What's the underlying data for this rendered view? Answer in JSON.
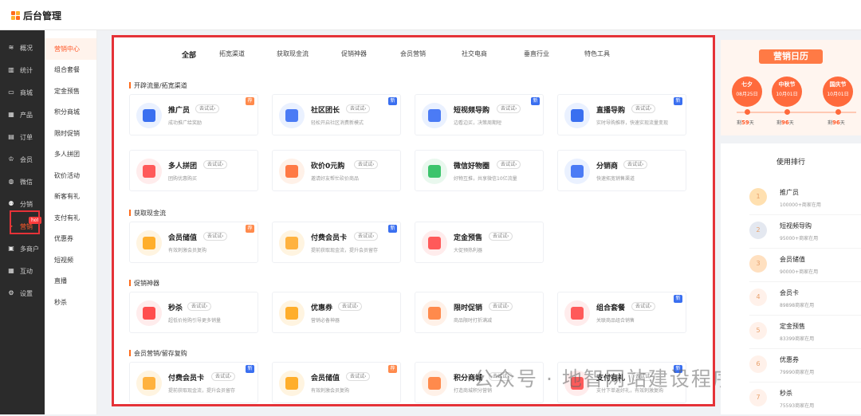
{
  "app": {
    "title": "后台管理"
  },
  "sidebar": {
    "items": [
      {
        "label": "概况",
        "icon": "layers-icon",
        "glyph": "≋"
      },
      {
        "label": "统计",
        "icon": "bar-chart-icon",
        "glyph": "▥"
      },
      {
        "label": "商城",
        "icon": "store-icon",
        "glyph": "▭"
      },
      {
        "label": "产品",
        "icon": "grid-icon",
        "glyph": "▦"
      },
      {
        "label": "订单",
        "icon": "order-icon",
        "glyph": "▤"
      },
      {
        "label": "会员",
        "icon": "crown-icon",
        "glyph": "♔"
      },
      {
        "label": "微信",
        "icon": "wechat-icon",
        "glyph": "◍"
      },
      {
        "label": "分销",
        "icon": "users-icon",
        "glyph": "⚉"
      },
      {
        "label": "营销",
        "icon": "marketing-icon",
        "glyph": "▸",
        "active": true,
        "badge": "hot"
      },
      {
        "label": "多商户",
        "icon": "merchant-icon",
        "glyph": "▣"
      },
      {
        "label": "互动",
        "icon": "interaction-icon",
        "glyph": "▦"
      },
      {
        "label": "设置",
        "icon": "gear-icon",
        "glyph": "⚙"
      }
    ]
  },
  "subnav": {
    "items": [
      "营销中心",
      "组合套餐",
      "定金预售",
      "积分商城",
      "限时促销",
      "多人拼团",
      "砍价活动",
      "新客有礼",
      "支付有礼",
      "优惠券",
      "短视频",
      "直播",
      "秒杀"
    ]
  },
  "tabs": [
    "全部",
    "拓宽渠道",
    "获取现金流",
    "促销神器",
    "会员营销",
    "社交电商",
    "垂直行业",
    "特色工具"
  ],
  "try_label": "去试试›",
  "sections": [
    {
      "title": "开辟流量/拓宽渠道",
      "cards": [
        {
          "name": "推广员",
          "desc": "成功推广给奖励",
          "tag": "荐",
          "tagColor": "#ff8a4c",
          "icon": "megaphone-icon",
          "bg": "#eaf1ff",
          "fg": "#3a6ff0"
        },
        {
          "name": "社区团长",
          "desc": "轻松开启社区消费新模式",
          "tag": "新",
          "tagColor": "#3a6ff0",
          "icon": "community-leader-icon",
          "bg": "#eaf1ff",
          "fg": "#4b7bf5"
        },
        {
          "name": "短视频导购",
          "desc": "边看边买，决策周期短",
          "tag": "新",
          "tagColor": "#3a6ff0",
          "icon": "video-shop-icon",
          "bg": "#eaf1ff",
          "fg": "#4b7bf5"
        },
        {
          "name": "直播导购",
          "desc": "实时导购推荐，快速实现流量变现",
          "tag": "新",
          "tagColor": "#3a6ff0",
          "icon": "live-icon",
          "bg": "#eaf1ff",
          "fg": "#3a6ff0"
        },
        {
          "name": "多人拼团",
          "desc": "团购优惠购买",
          "tag": "",
          "tagColor": "",
          "icon": "group-buy-icon",
          "bg": "#ffecec",
          "fg": "#ff5a5a"
        },
        {
          "name": "砍价0元购",
          "desc": "邀请好友帮忙砍价商品",
          "tag": "",
          "tagColor": "",
          "icon": "bargain-icon",
          "bg": "#fff1e8",
          "fg": "#ff7a45"
        },
        {
          "name": "微信好物圈",
          "desc": "好物互推，共享微信10亿流量",
          "tag": "",
          "tagColor": "",
          "icon": "wechat-circle-icon",
          "bg": "#e9f8ee",
          "fg": "#3cc46c"
        },
        {
          "name": "分销商",
          "desc": "快速拓宽销售渠道",
          "tag": "",
          "tagColor": "",
          "icon": "distributor-icon",
          "bg": "#eaf1ff",
          "fg": "#4b7bf5"
        }
      ]
    },
    {
      "title": "获取现金流",
      "cards": [
        {
          "name": "会员储值",
          "desc": "有效刺激会员复购",
          "tag": "荐",
          "tagColor": "#ff8a4c",
          "icon": "stored-value-icon",
          "bg": "#fff4e0",
          "fg": "#ffae2b"
        },
        {
          "name": "付费会员卡",
          "desc": "提前获取现金流，提升会员留存",
          "tag": "新",
          "tagColor": "#3a6ff0",
          "icon": "vip-card-icon",
          "bg": "#fff4e0",
          "fg": "#ffb23f"
        },
        {
          "name": "定金预售",
          "desc": "大促预热利器",
          "tag": "",
          "tagColor": "",
          "icon": "presale-icon",
          "bg": "#ffecec",
          "fg": "#ff5a5a"
        }
      ]
    },
    {
      "title": "促销神器",
      "cards": [
        {
          "name": "秒杀",
          "desc": "超低价抢购引导更多销量",
          "tag": "",
          "tagColor": "",
          "icon": "flash-sale-icon",
          "bg": "#ffecec",
          "fg": "#ff4d4d"
        },
        {
          "name": "优惠券",
          "desc": "营销必备神器",
          "tag": "",
          "tagColor": "",
          "icon": "coupon-icon",
          "bg": "#fff4e0",
          "fg": "#ffae2b"
        },
        {
          "name": "限时促销",
          "desc": "商品限时打折满减",
          "tag": "",
          "tagColor": "",
          "icon": "discount-icon",
          "bg": "#fff1e8",
          "fg": "#ff8a4c"
        },
        {
          "name": "组合套餐",
          "desc": "关联商品组合销售",
          "tag": "新",
          "tagColor": "#3a6ff0",
          "icon": "bundle-icon",
          "bg": "#ffecec",
          "fg": "#ff5a5a"
        }
      ]
    },
    {
      "title": "会员营销/留存复购",
      "cards": [
        {
          "name": "付费会员卡",
          "desc": "提前获取现金流，提升会员留存",
          "tag": "新",
          "tagColor": "#3a6ff0",
          "icon": "vip-card-icon",
          "bg": "#fff4e0",
          "fg": "#ffb23f"
        },
        {
          "name": "会员储值",
          "desc": "有效刺激会员复购",
          "tag": "荐",
          "tagColor": "#ff8a4c",
          "icon": "stored-value-icon",
          "bg": "#fff4e0",
          "fg": "#ffae2b"
        },
        {
          "name": "积分商城",
          "desc": "打造商城积分营销",
          "tag": "",
          "tagColor": "",
          "icon": "points-mall-icon",
          "bg": "#fff1e8",
          "fg": "#ff8a4c"
        },
        {
          "name": "支付有礼",
          "desc": "支付下单返好礼，有效刺激复购",
          "tag": "新",
          "tagColor": "#3a6ff0",
          "icon": "pay-gift-icon",
          "bg": "#ffecec",
          "fg": "#ff5a5a"
        }
      ]
    }
  ],
  "calendar": {
    "title": "营销日历",
    "festivals": [
      {
        "name": "七夕",
        "date": "08月25日",
        "remain_prefix": "剩",
        "days": "59",
        "unit": "天"
      },
      {
        "name": "中秋节",
        "date": "10月01日",
        "remain_prefix": "剩",
        "days": "96",
        "unit": "天"
      },
      {
        "name": "国庆节",
        "date": "10月01日",
        "remain_prefix": "剩",
        "days": "96",
        "unit": "天"
      }
    ]
  },
  "ranking": {
    "title": "使用排行",
    "items": [
      {
        "rank": "1",
        "name": "推广员",
        "count": "100000+商家在用"
      },
      {
        "rank": "2",
        "name": "短视频导购",
        "count": "95000+商家在用"
      },
      {
        "rank": "3",
        "name": "会员储值",
        "count": "90000+商家在用"
      },
      {
        "rank": "4",
        "name": "会员卡",
        "count": "89898商家在用"
      },
      {
        "rank": "5",
        "name": "定金预售",
        "count": "83399商家在用"
      },
      {
        "rank": "6",
        "name": "优惠券",
        "count": "79990商家在用"
      },
      {
        "rank": "7",
        "name": "秒杀",
        "count": "75593商家在用"
      }
    ]
  },
  "watermark": "公众号 · 地智网站建设程序开发",
  "colors": {
    "accent": "#ff5a2a",
    "highlight_box": "#e53238",
    "sidebar_bg": "#2b2b2b"
  }
}
